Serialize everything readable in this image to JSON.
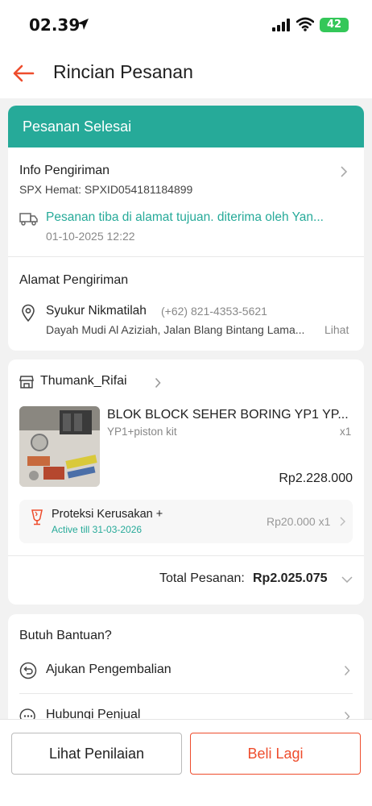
{
  "status_bar": {
    "time": "02.39",
    "battery": "42"
  },
  "header": {
    "title": "Rincian Pesanan"
  },
  "order_status": {
    "label": "Pesanan Selesai"
  },
  "shipping_info": {
    "title": "Info Pengiriman",
    "courier": "SPX Hemat: SPXID054181184899",
    "status": "Pesanan tiba di alamat tujuan. diterima oleh Yan...",
    "datetime": "01-10-2025 12:22"
  },
  "address": {
    "title": "Alamat Pengiriman",
    "name": "Syukur Nikmatilah",
    "phone": "(+62) 821-4353-5621",
    "line": "Dayah Mudi Al Aziziah, Jalan Blang Bintang Lama...",
    "link": "Lihat"
  },
  "shop": {
    "name": "Thumank_Rifai",
    "product": {
      "name": "BLOK BLOCK SEHER BORING YP1 YP...",
      "variant": "YP1+piston kit",
      "qty": "x1",
      "price": "Rp2.228.000"
    },
    "protection": {
      "title": "Proteksi Kerusakan +",
      "active": "Active till 31-03-2026",
      "price": "Rp20.000 x1"
    },
    "total_label": "Total Pesanan:",
    "total_value": "Rp2.025.075"
  },
  "help": {
    "title": "Butuh Bantuan?",
    "items": [
      {
        "label": "Ajukan Pengembalian"
      },
      {
        "label": "Hubungi Penjual"
      }
    ]
  },
  "actions": {
    "review": "Lihat Penilaian",
    "buy_again": "Beli Lagi"
  },
  "colors": {
    "accent": "#ee4d2d",
    "success": "#26aa99"
  }
}
